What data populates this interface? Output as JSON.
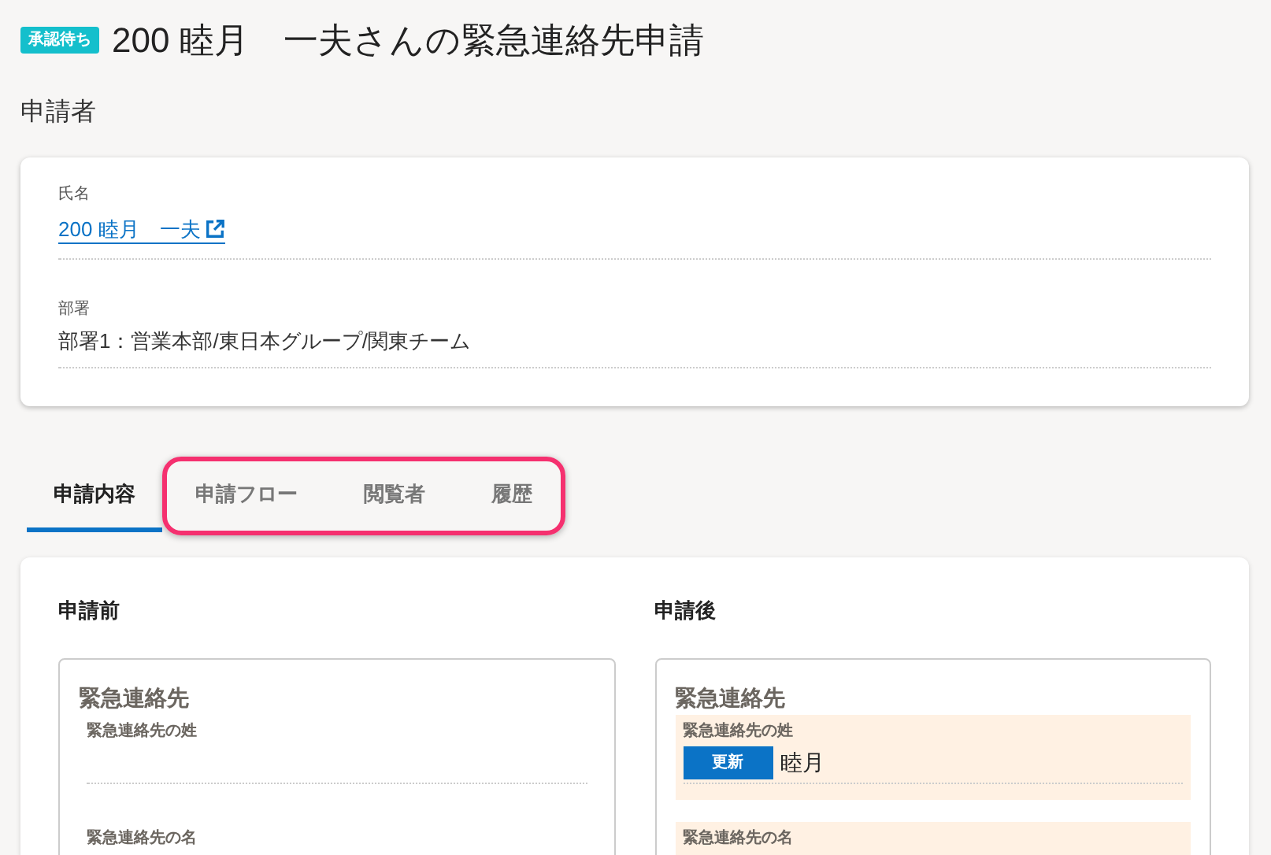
{
  "header": {
    "status_badge": "承認待ち",
    "title": "200 睦月　一夫さんの緊急連絡先申請"
  },
  "applicant": {
    "heading": "申請者",
    "fields": [
      {
        "kind": "link",
        "label": "氏名",
        "value": "200 睦月　一夫"
      },
      {
        "kind": "text",
        "label": "部署",
        "value": "部署1：営業本部/東日本グループ/関東チーム"
      }
    ]
  },
  "tabs": [
    {
      "label": "申請内容",
      "selected": true,
      "highlighted": false
    },
    {
      "label": "申請フロー",
      "selected": false,
      "highlighted": true
    },
    {
      "label": "閲覧者",
      "selected": false,
      "highlighted": true
    },
    {
      "label": "履歴",
      "selected": false,
      "highlighted": true
    }
  ],
  "comparison": [
    {
      "heading": "申請前",
      "section_title": "緊急連絡先",
      "fields": [
        {
          "label": "緊急連絡先の姓",
          "changed": false
        },
        {
          "label": "緊急連絡先の名",
          "changed": false
        }
      ]
    },
    {
      "heading": "申請後",
      "section_title": "緊急連絡先",
      "fields": [
        {
          "label": "緊急連絡先の姓",
          "changed": true,
          "badge": "更新",
          "value": "睦月"
        },
        {
          "label": "緊急連絡先の名",
          "changed": true
        }
      ]
    }
  ]
}
